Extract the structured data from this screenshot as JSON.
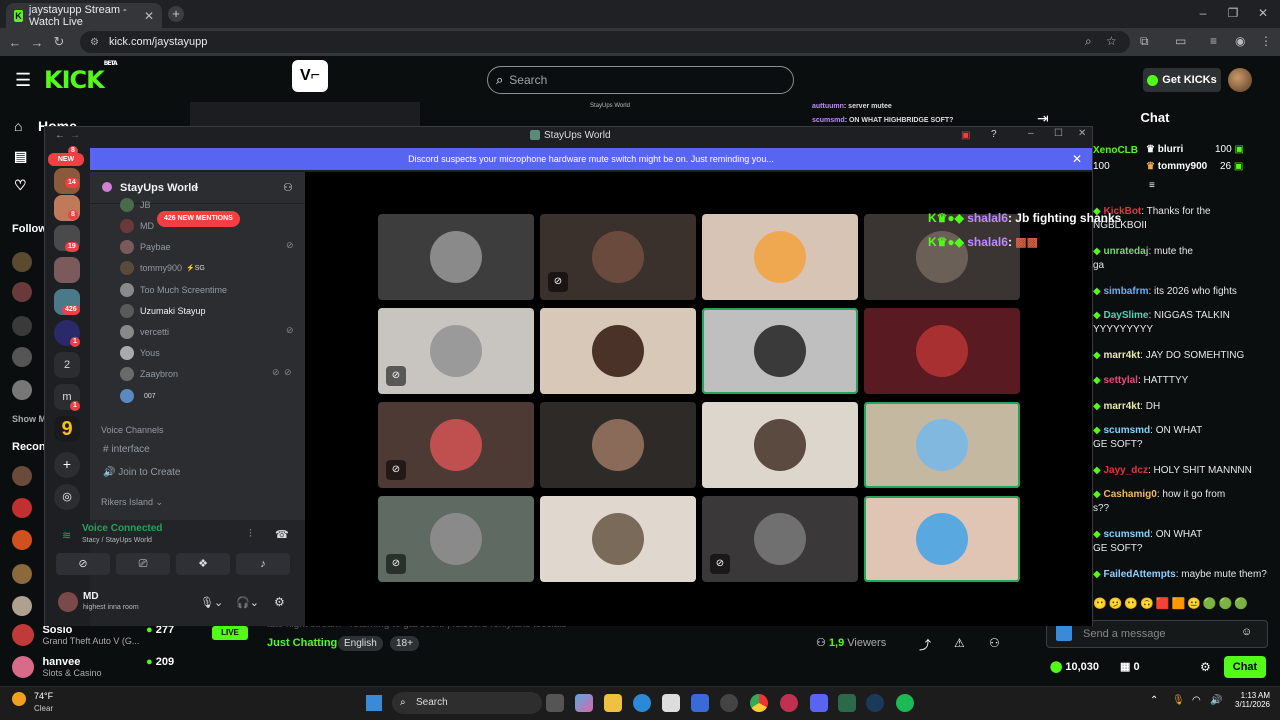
{
  "browser": {
    "tab_title": "jaystayupp Stream - Watch Live",
    "url": "kick.com/jaystayupp"
  },
  "kick": {
    "logo": "KICK",
    "logo_badge": "BETA",
    "search_placeholder": "Search",
    "get_kicks": "Get KICKs",
    "sidebar": {
      "home": "Home",
      "browse": "B",
      "following": "F",
      "followed_header": "Follow",
      "show_more": "Show M",
      "recommended_header": "Recon"
    },
    "recommended": [
      {
        "name": "Sosio",
        "category": "Grand Theft Auto V (G...",
        "viewers": "277",
        "color": "#c03a3a"
      },
      {
        "name": "hanvee",
        "category": "Slots & Casino",
        "viewers": "209",
        "color": "#d86a8a"
      }
    ],
    "stream": {
      "title": "late night stream - returning to gta soon! | !discord !onlyfans !socials",
      "live": "LIVE",
      "category": "Just Chatting",
      "tags": [
        "English",
        "18+"
      ],
      "viewers_count": "1,9",
      "viewers_label": "Viewers"
    },
    "chat": {
      "title": "Chat",
      "top_gifters": [
        {
          "name": "XenoCLB",
          "amount": "100"
        },
        {
          "name": "blurri",
          "amount": "100"
        },
        {
          "name": "tommy900",
          "amount": "26"
        }
      ],
      "messages": [
        {
          "user": "KickBot",
          "text": ": Thanks for the",
          "cont": "NGBLKBOII",
          "color": "#e0383f"
        },
        {
          "user": "unratedaj",
          "text": ": mute the",
          "cont": "ga",
          "color": "#73d96a"
        },
        {
          "user": "simbafrm",
          "text": ": its 2026 who fights",
          "cont": "",
          "color": "#5fb1ff"
        },
        {
          "user": "DaySlime",
          "text": ": NIGGAS TALKIN",
          "cont": "YYYYYYYYY",
          "color": "#53d1b3"
        },
        {
          "user": "marr4kt",
          "text": ": JAY DO SOMEHTING",
          "cont": "",
          "color": "#e8e8a8"
        },
        {
          "user": "settylal",
          "text": ": HATTTYY",
          "cont": "",
          "color": "#e0507a"
        },
        {
          "user": "marr4kt",
          "text": ": DH",
          "cont": "",
          "color": "#e8e8a8"
        },
        {
          "user": "scumsmd",
          "text": ": ON WHAT",
          "cont": "GE SOFT?",
          "color": "#7fd3ff"
        },
        {
          "user": "Jayy_dcz",
          "text": ": HOLY SHIT MANNNN",
          "cont": "",
          "color": "#e0383f"
        },
        {
          "user": "Cashamig0",
          "text": ": how it go from",
          "cont": "s??",
          "color": "#f0b860"
        },
        {
          "user": "scumsmd",
          "text": ": ON WHAT",
          "cont": "GE SOFT?",
          "color": "#7fd3ff"
        },
        {
          "user": "FailedAttempts",
          "text": ": maybe mute them?",
          "cont": "",
          "color": "#8fd0ff"
        }
      ],
      "send_placeholder": "Send a message",
      "points": "10,030",
      "zero": "0",
      "chat_button": "Chat"
    },
    "overlay": {
      "line1_user": "shalal6",
      "line1_text": "Jb fighting shanks",
      "line2_user": "shalal6",
      "top1_user": "auttuumn",
      "top1_text": "server mutee",
      "top2_user": "scumsmd",
      "top2_text": "ON WHAT HIGHBRIDGE SOFT?"
    }
  },
  "discord": {
    "window_title": "StayUps World",
    "banner": "Discord suspects your microphone hardware mute switch might be on. Just reminding you...",
    "server_name": "StayUps World",
    "new_badge": "NEW",
    "mentions_badge": "426 NEW MENTIONS",
    "server_badges": [
      "8",
      "14",
      "8",
      "19",
      "426",
      "1",
      "1"
    ],
    "folder_labels": [
      "2",
      "m"
    ],
    "members": [
      {
        "name": "JB",
        "extra": ""
      },
      {
        "name": "MD",
        "extra": ""
      },
      {
        "name": "Paybae",
        "extra": ""
      },
      {
        "name": "tommy900",
        "extra": "⚡SG"
      },
      {
        "name": "Too Much Screentime",
        "extra": ""
      },
      {
        "name": "Uzumaki Stayup",
        "extra": ""
      },
      {
        "name": "vercetti",
        "extra": ""
      },
      {
        "name": "Yous",
        "extra": ""
      },
      {
        "name": "Zaaybron",
        "extra": ""
      },
      {
        "name": "",
        "extra": "007"
      }
    ],
    "voice_channels_header": "Voice Channels",
    "channels": [
      "interface",
      "Join to Create"
    ],
    "category2": "Rikers Island",
    "voice_status": "Voice Connected",
    "voice_location": "Stacy / StayUps World",
    "user_name": "MD",
    "user_status": "highest inna room",
    "tiles": [
      {
        "bg": "#3d3d3d",
        "pic": "#8a8a8a",
        "mute": false,
        "talk": false
      },
      {
        "bg": "#3a302c",
        "pic": "#6b4a3e",
        "mute": true,
        "talk": false
      },
      {
        "bg": "#d8c4b4",
        "pic": "#f0a850",
        "mute": false,
        "talk": false
      },
      {
        "bg": "#3a3532",
        "pic": "#6a6058",
        "mute": false,
        "talk": false
      },
      {
        "bg": "#c8c4c0",
        "pic": "#9a9a9a",
        "mute": true,
        "talk": false
      },
      {
        "bg": "#d8c8b8",
        "pic": "#4a3228",
        "mute": false,
        "talk": false
      },
      {
        "bg": "#bfbfbf",
        "pic": "#3a3a3a",
        "mute": false,
        "talk": true
      },
      {
        "bg": "#5a1a22",
        "pic": "#a83030",
        "mute": false,
        "talk": false
      },
      {
        "bg": "#4e3a34",
        "pic": "#c05050",
        "mute": true,
        "talk": false
      },
      {
        "bg": "#2e2a28",
        "pic": "#8a6a58",
        "mute": false,
        "talk": false
      },
      {
        "bg": "#ddd6cc",
        "pic": "#5a4a40",
        "mute": false,
        "talk": false
      },
      {
        "bg": "#c4b8a0",
        "pic": "#80b8e0",
        "mute": false,
        "talk": true
      },
      {
        "bg": "#5e6a62",
        "pic": "#8a8a8a",
        "mute": true,
        "talk": false
      },
      {
        "bg": "#e0d8ce",
        "pic": "#7a6a5a",
        "mute": false,
        "talk": false
      },
      {
        "bg": "#3a3838",
        "pic": "#707070",
        "mute": true,
        "talk": false
      },
      {
        "bg": "#e0c4b4",
        "pic": "#5aa8e0",
        "mute": false,
        "talk": true
      }
    ]
  },
  "taskbar": {
    "temp": "74°F",
    "weather": "Clear",
    "search": "Search",
    "time": "1:13 AM",
    "date": "3/11/2026"
  },
  "colors": {
    "kick_green": "#53fc18",
    "discord_blurple": "#5865f2",
    "voice_green": "#23a55a"
  }
}
